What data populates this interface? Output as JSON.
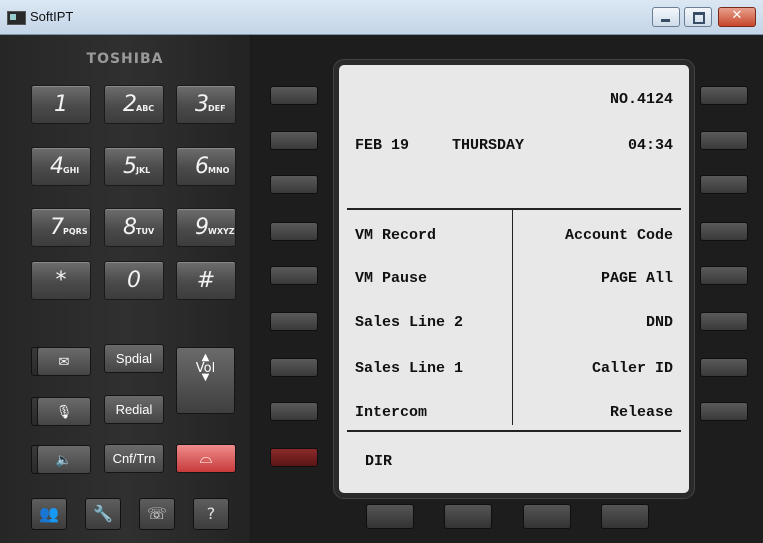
{
  "window": {
    "title": "SoftIPT"
  },
  "brand": "TOSHIBA",
  "dialpad": [
    {
      "digit": "1",
      "letters": ""
    },
    {
      "digit": "2",
      "letters": "ABC"
    },
    {
      "digit": "3",
      "letters": "DEF"
    },
    {
      "digit": "4",
      "letters": "GHI"
    },
    {
      "digit": "5",
      "letters": "JKL"
    },
    {
      "digit": "6",
      "letters": "MNO"
    },
    {
      "digit": "7",
      "letters": "PQRS"
    },
    {
      "digit": "8",
      "letters": "TUV"
    },
    {
      "digit": "9",
      "letters": "WXYZ"
    },
    {
      "digit": "*",
      "letters": ""
    },
    {
      "digit": "0",
      "letters": ""
    },
    {
      "digit": "#",
      "letters": ""
    }
  ],
  "function_keys": {
    "spdial": "Spdial",
    "redial": "Redial",
    "cnftrn": "Cnf/Trn",
    "vol": "Vol"
  },
  "lcd": {
    "number": "NO.4124",
    "date": "FEB 19",
    "day": "THURSDAY",
    "time": "04:34",
    "left_items": [
      "VM Record",
      "VM Pause",
      "Sales Line 2",
      "Sales Line 1",
      "Intercom"
    ],
    "right_items": [
      "Account Code",
      "PAGE All",
      "DND",
      "Caller ID",
      "Release"
    ],
    "bottom": "DIR"
  },
  "colors": {
    "message_key": "#e05555",
    "led_red": "#8a2a2a"
  }
}
